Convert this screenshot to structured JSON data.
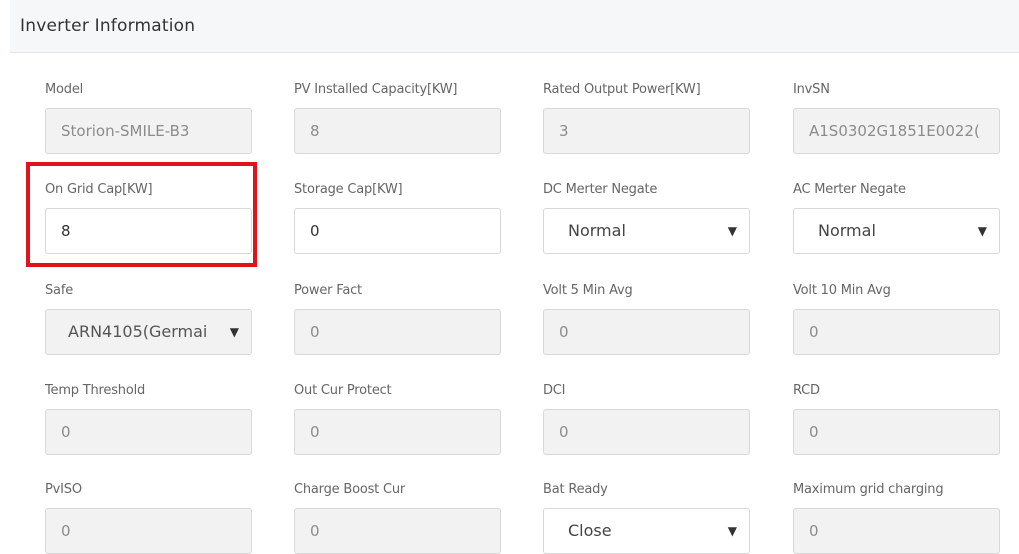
{
  "panel": {
    "title": "Inverter Information"
  },
  "fields": {
    "model": {
      "label": "Model",
      "value": "Storion-SMILE-B3"
    },
    "pv_capacity": {
      "label": "PV Installed Capacity[KW]",
      "value": "8"
    },
    "rated_output": {
      "label": "Rated Output Power[KW]",
      "value": "3"
    },
    "invsn": {
      "label": "InvSN",
      "value": "A1S0302G1851E0022("
    },
    "on_grid_cap": {
      "label": "On Grid Cap[KW]",
      "value": "8"
    },
    "storage_cap": {
      "label": "Storage Cap[KW]",
      "value": "0"
    },
    "dc_merter_negate": {
      "label": "DC Merter Negate",
      "value": "Normal"
    },
    "ac_merter_negate": {
      "label": "AC Merter Negate",
      "value": "Normal"
    },
    "safe": {
      "label": "Safe",
      "value": "ARN4105(Germai"
    },
    "power_fact": {
      "label": "Power Fact",
      "value": "0"
    },
    "volt_5_min_avg": {
      "label": "Volt 5 Min Avg",
      "value": "0"
    },
    "volt_10_min_avg": {
      "label": "Volt 10 Min Avg",
      "value": "0"
    },
    "temp_threshold": {
      "label": "Temp Threshold",
      "value": "0"
    },
    "out_cur_protect": {
      "label": "Out Cur Protect",
      "value": "0"
    },
    "dci": {
      "label": "DCI",
      "value": "0"
    },
    "rcd": {
      "label": "RCD",
      "value": "0"
    },
    "pviso": {
      "label": "PvISO",
      "value": "0"
    },
    "charge_boost_cur": {
      "label": "Charge Boost Cur",
      "value": "0"
    },
    "bat_ready": {
      "label": "Bat Ready",
      "value": "Close"
    },
    "max_grid_charging": {
      "label": "Maximum grid charging",
      "value": "0"
    }
  },
  "icons": {
    "dropdown": "chevron-down-icon",
    "caret_glyph": "▼"
  },
  "colors": {
    "highlight": "#e0131c",
    "readonly_bg": "#f2f2f2",
    "header_bg": "#f6f7f9"
  }
}
